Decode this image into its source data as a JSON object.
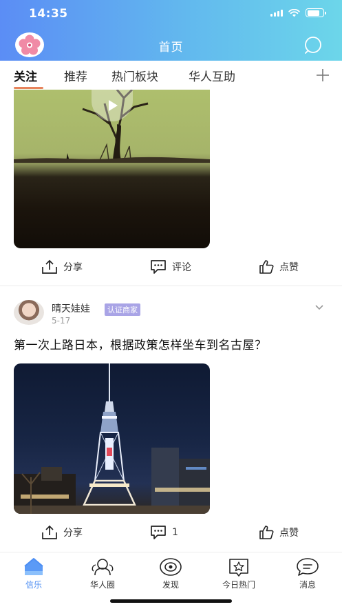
{
  "status_bar": {
    "time": "14:35"
  },
  "header": {
    "title": "首页",
    "logo_icon": "cherry-blossom-icon",
    "search_icon": "search-icon"
  },
  "tabs": {
    "items": [
      {
        "label": "关注",
        "active": true
      },
      {
        "label": "推荐",
        "active": false
      },
      {
        "label": "热门板块",
        "active": false
      },
      {
        "label": "华人互助",
        "active": false
      }
    ],
    "add_icon": "plus-icon",
    "accent": "#e7835c"
  },
  "feed": {
    "posts": [
      {
        "media_type": "video",
        "actions": {
          "share": "分享",
          "comment": "评论",
          "like": "点赞"
        }
      },
      {
        "author": "晴天娃娃",
        "badge": "认证商家",
        "date": "5-17",
        "title": "第一次上路日本，根据政策怎样坐车到名古屋？",
        "media_type": "image",
        "actions": {
          "share": "分享",
          "comment": "1",
          "like": "点赞"
        }
      }
    ]
  },
  "bottom_nav": {
    "items": [
      {
        "label": "信乐",
        "icon": "home-icon",
        "active": true
      },
      {
        "label": "华人圈",
        "icon": "group-icon",
        "active": false
      },
      {
        "label": "发现",
        "icon": "discover-icon",
        "active": false
      },
      {
        "label": "今日热门",
        "icon": "trending-icon",
        "active": false
      },
      {
        "label": "消息",
        "icon": "message-icon",
        "active": false
      }
    ],
    "active_color": "#4d8ef3"
  }
}
